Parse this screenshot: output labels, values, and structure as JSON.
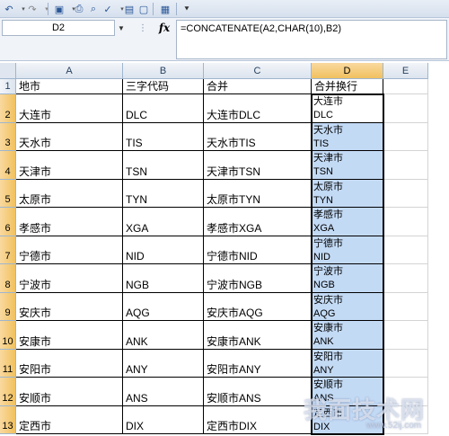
{
  "name_box": "D2",
  "fx_label": "fx",
  "formula": "=CONCATENATE(A2,CHAR(10),B2)",
  "toolbar_icons": [
    "undo-icon",
    "redo-icon",
    "save-icon",
    "print-icon",
    "print-preview-icon",
    "spell-icon",
    "open-icon",
    "new-icon",
    "sort-icon",
    "customize-icon"
  ],
  "columns": [
    "A",
    "B",
    "C",
    "D",
    "E"
  ],
  "row_numbers": [
    "1",
    "2",
    "3",
    "4",
    "5",
    "6",
    "7",
    "8",
    "9",
    "10",
    "11",
    "12",
    "13"
  ],
  "header_row": {
    "a": "地市",
    "b": "三字代码",
    "c": "合并",
    "d": "合并换行"
  },
  "rows": [
    {
      "a": "大连市",
      "b": "DLC",
      "c": "大连市DLC",
      "d1": "大连市",
      "d2": "DLC"
    },
    {
      "a": "天水市",
      "b": "TIS",
      "c": "天水市TIS",
      "d1": "天水市",
      "d2": "TIS"
    },
    {
      "a": "天津市",
      "b": "TSN",
      "c": "天津市TSN",
      "d1": "天津市",
      "d2": "TSN"
    },
    {
      "a": "太原市",
      "b": "TYN",
      "c": "太原市TYN",
      "d1": "太原市",
      "d2": "TYN"
    },
    {
      "a": "孝感市",
      "b": "XGA",
      "c": "孝感市XGA",
      "d1": "孝感市",
      "d2": "XGA"
    },
    {
      "a": "宁德市",
      "b": "NID",
      "c": "宁德市NID",
      "d1": "宁德市",
      "d2": "NID"
    },
    {
      "a": "宁波市",
      "b": "NGB",
      "c": "宁波市NGB",
      "d1": "宁波市",
      "d2": "NGB"
    },
    {
      "a": "安庆市",
      "b": "AQG",
      "c": "安庆市AQG",
      "d1": "安庆市",
      "d2": "AQG"
    },
    {
      "a": "安康市",
      "b": "ANK",
      "c": "安康市ANK",
      "d1": "安康市",
      "d2": "ANK"
    },
    {
      "a": "安阳市",
      "b": "ANY",
      "c": "安阳市ANY",
      "d1": "安阳市",
      "d2": "ANY"
    },
    {
      "a": "安顺市",
      "b": "ANS",
      "c": "安顺市ANS",
      "d1": "安顺市",
      "d2": "ANS"
    },
    {
      "a": "定西市",
      "b": "DIX",
      "c": "定西市DIX",
      "d1": "定西市",
      "d2": "DIX"
    }
  ],
  "watermark": {
    "text": "我面技术网",
    "url": "www.52ij.com"
  },
  "colors": {
    "selection": "#c3daf5",
    "header_selected": "#f1c15f"
  }
}
